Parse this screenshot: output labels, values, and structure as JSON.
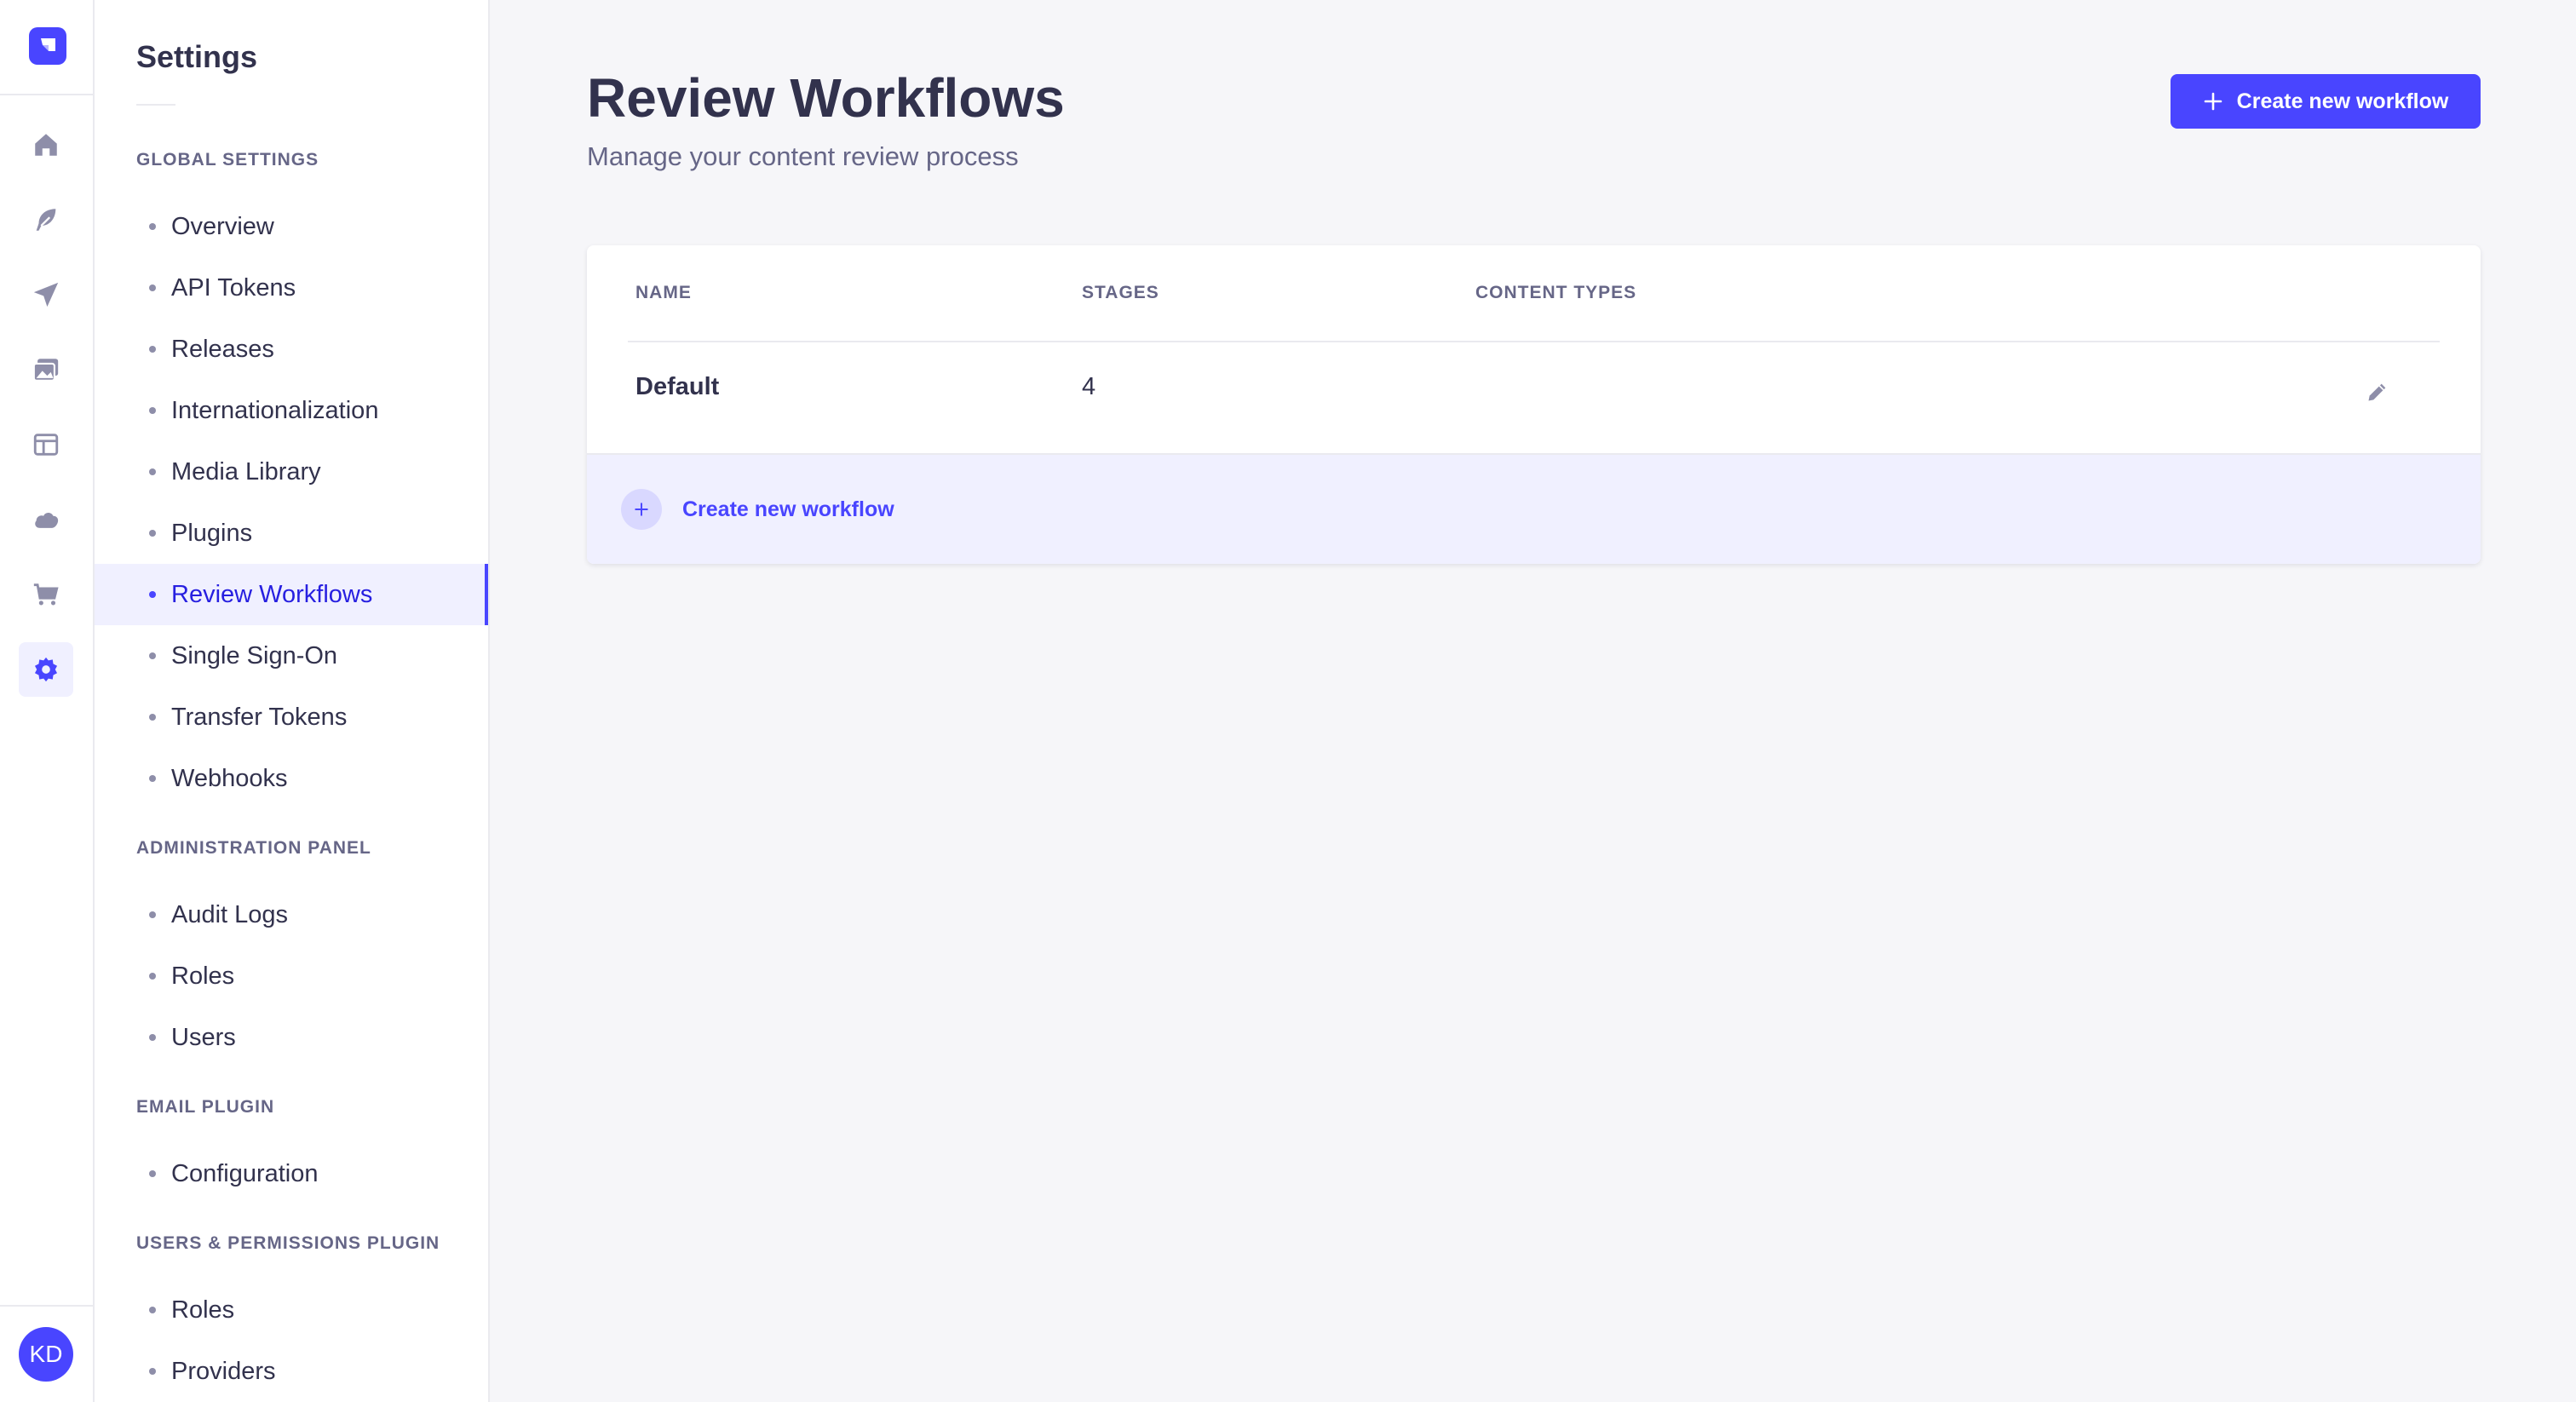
{
  "app": {
    "accent_color": "#4945ff"
  },
  "rail": {
    "items": [
      {
        "name": "home-icon",
        "active": false
      },
      {
        "name": "feather-icon",
        "active": false
      },
      {
        "name": "send-icon",
        "active": false
      },
      {
        "name": "media-icon",
        "active": false
      },
      {
        "name": "layout-icon",
        "active": false
      },
      {
        "name": "cloud-icon",
        "active": false
      },
      {
        "name": "cart-icon",
        "active": false
      },
      {
        "name": "settings-icon",
        "active": true
      }
    ],
    "avatar_initials": "KD"
  },
  "subnav": {
    "title": "Settings",
    "sections": [
      {
        "label": "Global Settings",
        "items": [
          "Overview",
          "API Tokens",
          "Releases",
          "Internationalization",
          "Media Library",
          "Plugins",
          "Review Workflows",
          "Single Sign-On",
          "Transfer Tokens",
          "Webhooks"
        ]
      },
      {
        "label": "Administration Panel",
        "items": [
          "Audit Logs",
          "Roles",
          "Users"
        ]
      },
      {
        "label": "Email Plugin",
        "items": [
          "Configuration"
        ]
      },
      {
        "label": "Users & Permissions Plugin",
        "items": [
          "Roles",
          "Providers"
        ]
      }
    ],
    "active_item": "Review Workflows"
  },
  "header": {
    "title": "Review Workflows",
    "subtitle": "Manage your content review process",
    "create_button_label": "Create new workflow"
  },
  "table": {
    "columns": [
      "Name",
      "Stages",
      "Content Types"
    ],
    "rows": [
      {
        "name": "Default",
        "stages": "4",
        "content_types": ""
      }
    ],
    "footer_add_label": "Create new workflow"
  }
}
